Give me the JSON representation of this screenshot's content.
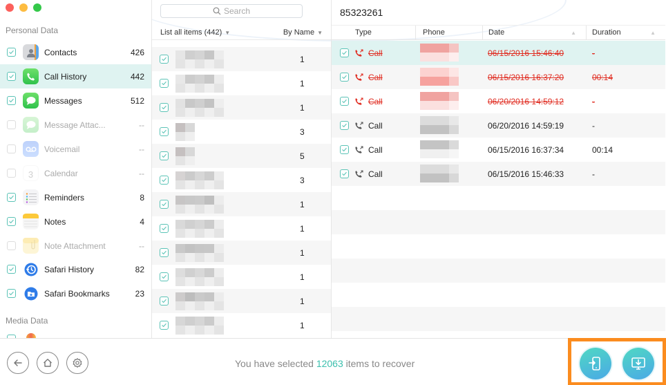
{
  "window": {
    "traffic_lights": [
      "close",
      "minimize",
      "maximize"
    ]
  },
  "sidebar": {
    "section_personal": "Personal Data",
    "section_media": "Media Data",
    "items": [
      {
        "label": "Contacts",
        "count": "426",
        "checked": true,
        "enabled": true,
        "icon": "contacts-icon",
        "color": "#a9adb3"
      },
      {
        "label": "Call History",
        "count": "442",
        "checked": true,
        "enabled": true,
        "active": true,
        "icon": "phone-icon",
        "color": "#3dd15a"
      },
      {
        "label": "Messages",
        "count": "512",
        "checked": true,
        "enabled": true,
        "icon": "messages-icon",
        "color": "#3dd15a"
      },
      {
        "label": "Message Attac...",
        "count": "--",
        "checked": false,
        "enabled": false,
        "icon": "message-attachment-icon",
        "color": "#6fd880"
      },
      {
        "label": "Voicemail",
        "count": "--",
        "checked": false,
        "enabled": false,
        "icon": "voicemail-icon",
        "color": "#5b8ef5"
      },
      {
        "label": "Calendar",
        "count": "--",
        "checked": false,
        "enabled": false,
        "icon": "calendar-icon",
        "color": "#ffffff"
      },
      {
        "label": "Reminders",
        "count": "8",
        "checked": true,
        "enabled": true,
        "icon": "reminders-icon",
        "color": "#f4f4f6"
      },
      {
        "label": "Notes",
        "count": "4",
        "checked": true,
        "enabled": true,
        "icon": "notes-icon",
        "color": "#f6f6f6"
      },
      {
        "label": "Note Attachment",
        "count": "--",
        "checked": false,
        "enabled": false,
        "icon": "note-attachment-icon",
        "color": "#fbe9a6"
      },
      {
        "label": "Safari History",
        "count": "82",
        "checked": true,
        "enabled": true,
        "icon": "safari-history-icon",
        "color": "#2f7ce8"
      },
      {
        "label": "Safari Bookmarks",
        "count": "23",
        "checked": true,
        "enabled": true,
        "icon": "safari-bookmarks-icon",
        "color": "#2f7ce8"
      }
    ]
  },
  "list": {
    "search_placeholder": "Search",
    "filter_label": "List all items (442)",
    "sort_label": "By Name",
    "rows": [
      {
        "count": "1",
        "checked": true
      },
      {
        "count": "1",
        "checked": true
      },
      {
        "count": "1",
        "checked": true
      },
      {
        "count": "3",
        "checked": true
      },
      {
        "count": "5",
        "checked": true
      },
      {
        "count": "3",
        "checked": true
      },
      {
        "count": "1",
        "checked": true
      },
      {
        "count": "1",
        "checked": true
      },
      {
        "count": "1",
        "checked": true
      },
      {
        "count": "1",
        "checked": true
      },
      {
        "count": "1",
        "checked": true
      },
      {
        "count": "1",
        "checked": true
      }
    ]
  },
  "detail": {
    "title": "85323261",
    "columns": {
      "type": "Type",
      "phone": "Phone",
      "date": "Date",
      "duration": "Duration"
    },
    "rows": [
      {
        "type": "Call",
        "date": "06/15/2016 15:46:40",
        "duration": "-",
        "deleted": true,
        "checked": true
      },
      {
        "type": "Call",
        "date": "06/15/2016 16:37:20",
        "duration": "00:14",
        "deleted": true,
        "checked": true
      },
      {
        "type": "Call",
        "date": "06/20/2016 14:59:12",
        "duration": "-",
        "deleted": true,
        "checked": true
      },
      {
        "type": "Call",
        "date": "06/20/2016 14:59:19",
        "duration": "-",
        "deleted": false,
        "checked": true
      },
      {
        "type": "Call",
        "date": "06/15/2016 16:37:34",
        "duration": "00:14",
        "deleted": false,
        "checked": true
      },
      {
        "type": "Call",
        "date": "06/15/2016 15:46:33",
        "duration": "-",
        "deleted": false,
        "checked": true
      }
    ]
  },
  "footer": {
    "status_prefix": "You have selected",
    "status_count": "12063",
    "status_suffix": "items to recover",
    "buttons": {
      "back": "back-icon",
      "home": "home-icon",
      "settings": "gear-icon",
      "to_device": "recover-to-device-icon",
      "to_computer": "recover-to-computer-icon"
    }
  },
  "colors": {
    "accent": "#3bbfad",
    "deleted": "#e02b20",
    "highlight_box": "#fb8c1f",
    "active_row": "#dff3f1"
  }
}
